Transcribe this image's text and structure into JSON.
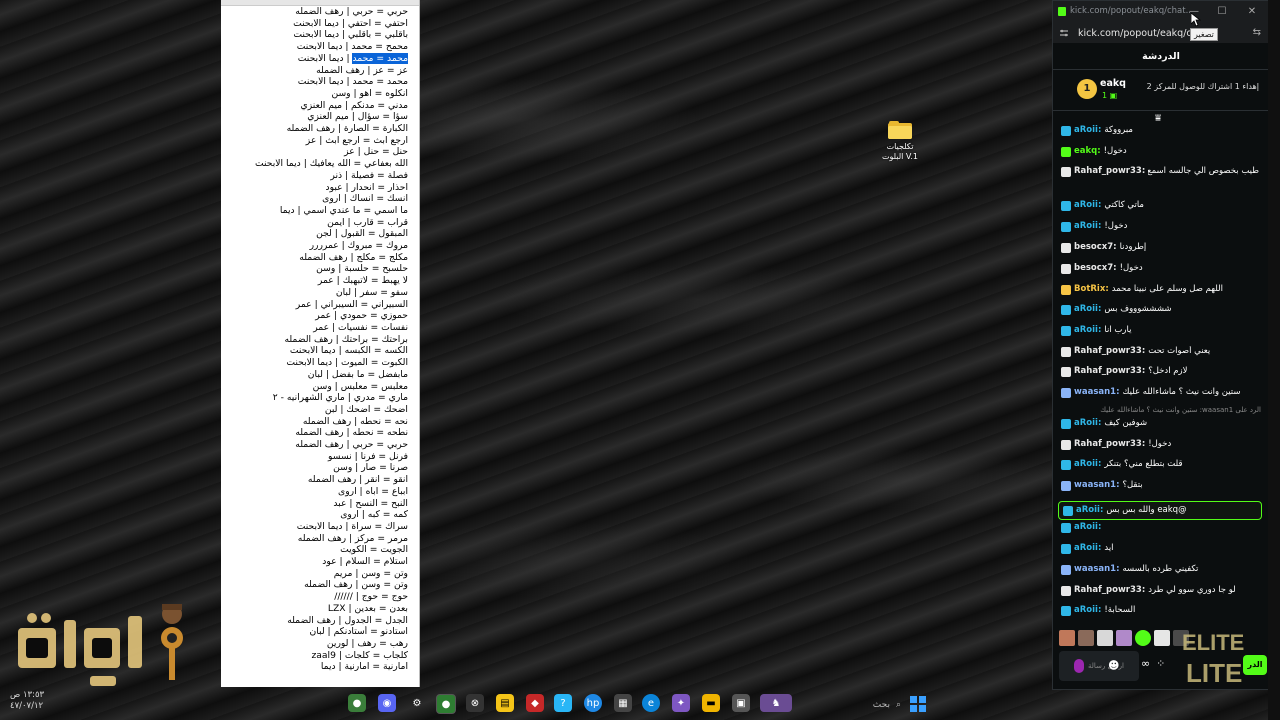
{
  "notepad": {
    "lines": [
      "حربي = حربي | رهف الضمله",
      "احتفي = احتفي | ديما الابحنت",
      "باقلبي = باقلبي | ديما الابحنت",
      "محمح = محمد | ديما الابحنت",
      "محمد = محمد | ديما الابحنت",
      "عز = عز | رهف الضمله",
      "محمد = محمد | ديما الابحنت",
      "انكلوه = اهو | وسن",
      "مدني = مدنكم | ميم العنزي",
      "سؤا = سؤال | ميم العنزي",
      "الكبارة = الصارة | رهف الضمله",
      "ارجع ابث = ارجع ابث | عز",
      "حنل = حنل | عز",
      "الله بعفاعي = الله يعافيك | ديما الابحنت",
      "فصلة = فصيلة | ذنر",
      "احذار = انحدار | عبود",
      "انسك = انساك | اروى",
      "ما اسمي = ما عندي اسمي | ديما",
      "قراب = قارب | ايمن",
      "المبقول = القبول | لجن",
      "مروك = مبروك | عمرررر",
      "مكلج = مكلج | رهف الضمله",
      "حلسبح = حلسبة | وسن",
      "لا يهبط = لاتبهبك | عمر",
      "سفو = سفر | لبان",
      "السبيراني = السيبراني | عمر",
      "حموزي = حمودي | عمر",
      "نفسات = نفسيات | عمر",
      "براحتك = براحتك | رهف الضمله",
      "الكسه = الكبسه | ديما الابحنت",
      "الكبوت = الميوت | ديما الابحنت",
      "مابفضل = ما بفضل | لبان",
      "معلبس = معلبس | وسن",
      "ماري = مدري | ماري الشهرانيه - ٢",
      "اضحك = اضحك | لبن",
      "نحه = نحطه | رهف الضمله",
      "نطحه = نحطه | رهف الضمله",
      "حربي = حربي | رهف الضمله",
      "فرنل = فرنا | نسسو",
      "صرنا = صار | وسن",
      "انقو = انقر | رهف الضمله",
      "ابباع = اباه | اروى",
      "النبح = النسح | عبد",
      "كمه = كبه | اروى",
      "سراك = سراة | ديما الابحنت",
      "مرمر = مركز | رهف الضمله",
      "الجويت = الكويت",
      "استلام = السلام | عود",
      "وتن = وسن | مريم",
      "وتن = وسن | رهف الضمله",
      "حوج = حوج | //////",
      "بعدن = بعدين | LZX",
      "الجدل = الجدول | رهف الضمله",
      "استادنو = أستادنكم | لبان",
      "رهب = رهف | لورين",
      "كلجاب = كلجات | zaal9",
      "امارنية = امارنية | ديما"
    ],
    "selected_line_index": 4,
    "selected_text": "محمد = محمد"
  },
  "desktop": {
    "folder_label_line1": "تكلجيات",
    "folder_label_line2": "V.1 البلوت"
  },
  "logo": {
    "text": "لنابغة"
  },
  "clock": {
    "time": "١٣:٥٣ ص",
    "date": "٤٧/٠٧/١٢"
  },
  "taskbar": {
    "search_placeholder": "بحث",
    "icons": [
      "chrome-icon",
      "discord-icon",
      "settings-icon",
      "chrome-icon",
      "xbox-icon",
      "notes-icon",
      "antivirus-icon",
      "help-icon",
      "hp-icon",
      "store-icon",
      "edge-icon",
      "copilot-icon",
      "file-explorer-icon",
      "taskview-icon",
      "game-icon"
    ]
  },
  "chat_window": {
    "title": "kick.com/popout/eakq/chat...",
    "url": "kick.com/popout/eakq/chat",
    "tooltip": "تصغير",
    "header": "الدردشة",
    "sub_goal": {
      "count": "1",
      "channel": "eakq",
      "count_sub": "1",
      "text": "إهداء 1 اشتراك للوصول للمركز 2"
    },
    "messages": [
      {
        "user": "aRoii",
        "text": "مبرووكة",
        "color": "#2fb7e8"
      },
      {
        "user": "eakq",
        "text": "دخول!",
        "color": "#53fc18"
      },
      {
        "user": "Rahaf_powr33",
        "text": "طيب بخصوص الي جالسه اسمع صوت تحت",
        "color": "#e8e8e8"
      },
      {
        "user": "aRoii",
        "text": "ماتي كاكتي",
        "color": "#2fb7e8"
      },
      {
        "user": "aRoii",
        "text": "دخول!",
        "color": "#2fb7e8"
      },
      {
        "user": "besocx7",
        "text": "إطرودنا",
        "color": "#e8e8e8"
      },
      {
        "user": "besocx7",
        "text": "دخول!",
        "color": "#e8e8e8"
      },
      {
        "user": "BotRix",
        "text": "اللهم صل وسلم على نبينا محمد",
        "color": "#f6c445"
      },
      {
        "user": "aRoii",
        "text": "ششششوووف بس",
        "color": "#2fb7e8"
      },
      {
        "user": "aRoii",
        "text": "يارب انا",
        "color": "#2fb7e8"
      },
      {
        "user": "Rahaf_powr33",
        "text": "يعني أصوات تحت",
        "color": "#e8e8e8"
      },
      {
        "user": "Rahaf_powr33",
        "text": "لازم ادخل؟",
        "color": "#e8e8e8"
      },
      {
        "user": "waasan1",
        "text": "ستين وانت نيث ؟ ماشاءالله عليك",
        "color": "#8ab4f8"
      },
      {
        "user": "aRoii",
        "text": "شوفين كيف",
        "color": "#2fb7e8"
      },
      {
        "user": "Rahaf_powr33",
        "text": "دخول!",
        "color": "#e8e8e8"
      },
      {
        "user": "aRoii",
        "text": "قلت بتطلع مني؟ بتنكر",
        "color": "#2fb7e8"
      },
      {
        "user": "waasan1",
        "text": "بتقل؟",
        "color": "#8ab4f8"
      },
      {
        "user": "aRoii",
        "text": "@eakq والله بس بس",
        "color": "#2fb7e8"
      },
      {
        "user": "aRoii",
        "text": "",
        "color": "#2fb7e8"
      },
      {
        "user": "aRoii",
        "text": "ايد",
        "color": "#2fb7e8"
      },
      {
        "user": "waasan1",
        "text": "تكفيني طرده بالسسه",
        "color": "#8ab4f8"
      },
      {
        "user": "Rahaf_powr33",
        "text": "لو جا دوري سوو لي طرد",
        "color": "#e8e8e8"
      },
      {
        "user": "aRoii",
        "text": "السحابة!",
        "color": "#2fb7e8"
      }
    ],
    "reply_hint": "الرد على waasan1: ستين وانت نيث ؟ ماشاءالله عليك",
    "input_placeholder": "ارسل رسالة",
    "send_label": "الدر"
  }
}
